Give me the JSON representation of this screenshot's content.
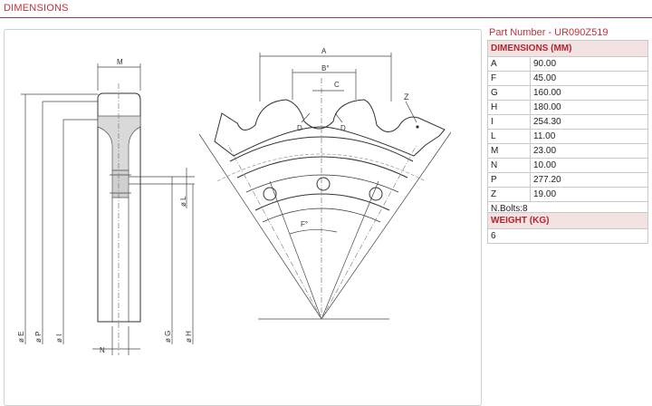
{
  "header": {
    "title": "DIMENSIONS"
  },
  "part_number": "Part Number - UR090Z519",
  "dimensions": {
    "heading": "DIMENSIONS (MM)",
    "rows": [
      {
        "key": "A",
        "value": "90.00"
      },
      {
        "key": "F",
        "value": "45.00"
      },
      {
        "key": "G",
        "value": "160.00"
      },
      {
        "key": "H",
        "value": "180.00"
      },
      {
        "key": "I",
        "value": "254.30"
      },
      {
        "key": "L",
        "value": "11.00"
      },
      {
        "key": "M",
        "value": "23.00"
      },
      {
        "key": "N",
        "value": "10.00"
      },
      {
        "key": "P",
        "value": "277.20"
      },
      {
        "key": "Z",
        "value": "19.00"
      }
    ],
    "bolts": "N.Bolts:8"
  },
  "weight": {
    "heading": "WEIGHT (KG)",
    "value": "6"
  },
  "drawing": {
    "labels": {
      "M": "M",
      "A": "A",
      "B": "B°",
      "C": "C",
      "Z": "Z",
      "D1": "D",
      "D2": "D",
      "F": "F°",
      "L": "ø L",
      "N": "N",
      "E": "ø E",
      "P": "ø P",
      "I": "ø I",
      "G": "ø G",
      "H": "ø H"
    }
  }
}
